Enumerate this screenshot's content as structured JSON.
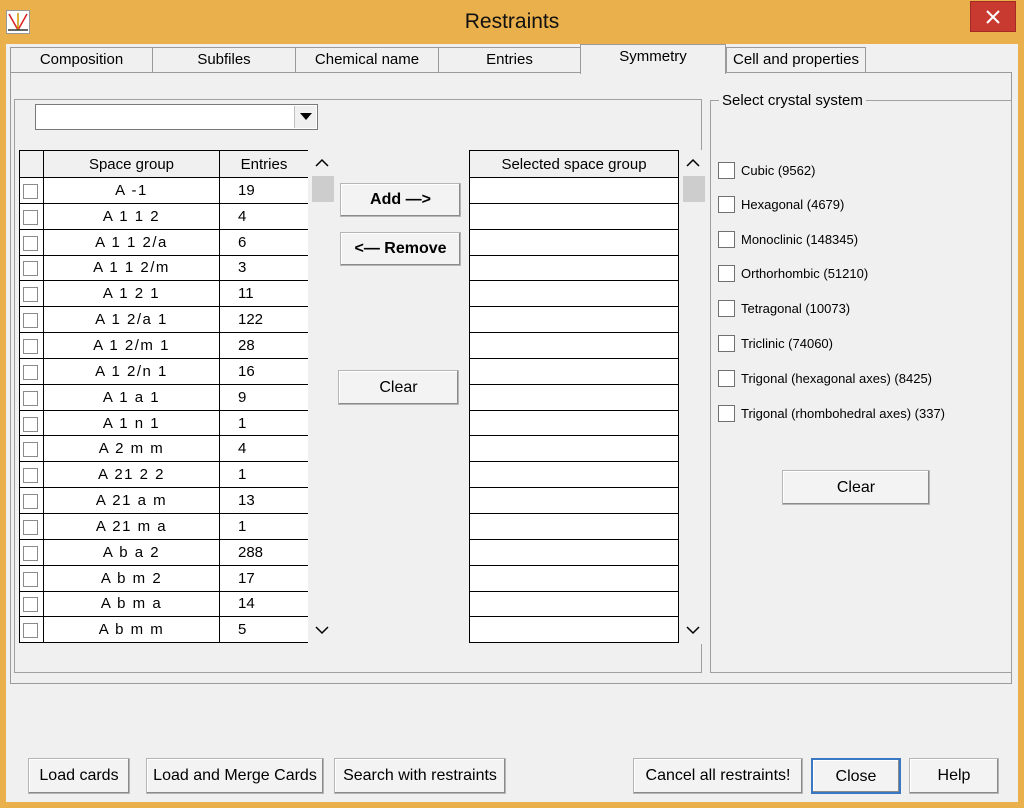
{
  "window": {
    "title": "Restraints",
    "icon": "crystal-app-icon"
  },
  "tabs": [
    {
      "label": "Composition"
    },
    {
      "label": "Subfiles"
    },
    {
      "label": "Chemical name"
    },
    {
      "label": "Entries"
    },
    {
      "label": "Symmetry",
      "active": true
    },
    {
      "label": "Cell and properties"
    }
  ],
  "filter_combo": {
    "value": ""
  },
  "space_group_table": {
    "headers": [
      "Space group",
      "Entries"
    ],
    "rows": [
      {
        "group": "A -1",
        "entries": "19"
      },
      {
        "group": "A 1 1 2",
        "entries": "4"
      },
      {
        "group": "A 1 1 2/a",
        "entries": "6"
      },
      {
        "group": "A 1 1 2/m",
        "entries": "3"
      },
      {
        "group": "A 1 2 1",
        "entries": "11"
      },
      {
        "group": "A 1 2/a 1",
        "entries": "122"
      },
      {
        "group": "A 1 2/m 1",
        "entries": "28"
      },
      {
        "group": "A 1 2/n 1",
        "entries": "16"
      },
      {
        "group": "A 1 a 1",
        "entries": "9"
      },
      {
        "group": "A 1 n 1",
        "entries": "1"
      },
      {
        "group": "A 2 m m",
        "entries": "4"
      },
      {
        "group": "A 21 2 2",
        "entries": "1"
      },
      {
        "group": "A 21 a m",
        "entries": "13"
      },
      {
        "group": "A 21 m a",
        "entries": "1"
      },
      {
        "group": "A b a 2",
        "entries": "288"
      },
      {
        "group": "A b m 2",
        "entries": "17"
      },
      {
        "group": "A b m a",
        "entries": "14"
      },
      {
        "group": "A b m m",
        "entries": "5"
      }
    ]
  },
  "selected_table": {
    "header": "Selected space group",
    "rows": [
      "",
      "",
      "",
      "",
      "",
      "",
      "",
      "",
      "",
      "",
      "",
      "",
      "",
      "",
      "",
      "",
      "",
      ""
    ]
  },
  "middle_buttons": {
    "add": "Add —>",
    "remove": "<— Remove",
    "clear": "Clear"
  },
  "crystal_system": {
    "legend": "Select crystal system",
    "items": [
      {
        "label": "Cubic (9562)"
      },
      {
        "label": "Hexagonal (4679)"
      },
      {
        "label": "Monoclinic (148345)"
      },
      {
        "label": "Orthorhombic (51210)"
      },
      {
        "label": "Tetragonal (10073)"
      },
      {
        "label": "Triclinic (74060)"
      },
      {
        "label": "Trigonal (hexagonal axes) (8425)"
      },
      {
        "label": "Trigonal (rhombohedral axes) (337)"
      }
    ],
    "clear": "Clear"
  },
  "bottom_buttons": {
    "load_cards": "Load cards",
    "load_merge": "Load and Merge Cards",
    "search": "Search with restraints",
    "cancel_all": "Cancel all restraints!",
    "close": "Close",
    "help": "Help"
  },
  "colors": {
    "titlebar": "#e9b04b",
    "close": "#c8392f",
    "panel": "#f0f0f0"
  }
}
